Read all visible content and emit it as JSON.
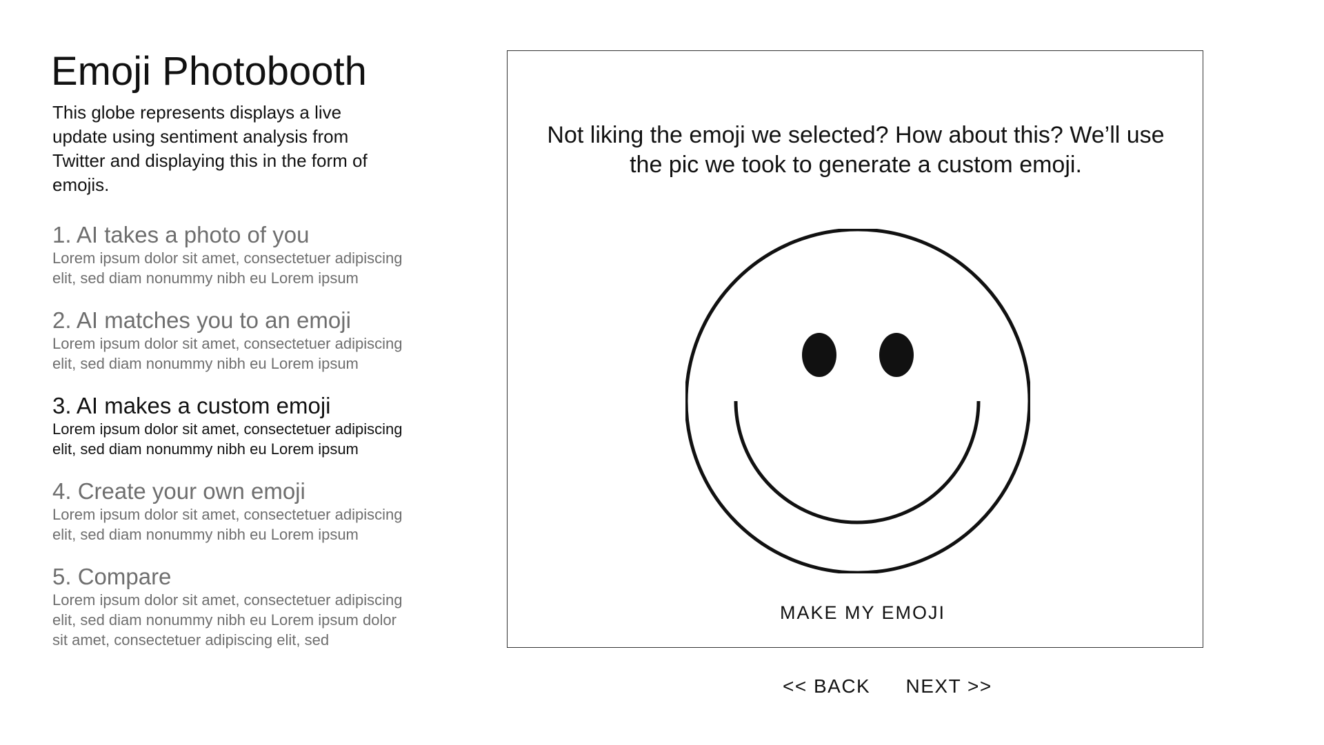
{
  "header": {
    "title": "Emoji Photobooth",
    "intro": "This globe represents displays a live update using sentiment analysis from Twitter and displaying this in the form of emojis."
  },
  "steps": [
    {
      "title": "1. AI takes a photo of you",
      "desc": "Lorem ipsum dolor sit amet, consectetuer adipiscing elit, sed diam nonummy nibh eu Lorem ipsum",
      "active": false
    },
    {
      "title": "2. AI matches you to an emoji",
      "desc": "Lorem ipsum dolor sit amet, consectetuer adipiscing elit, sed diam nonummy nibh eu Lorem ipsum",
      "active": false
    },
    {
      "title": "3. AI makes a custom emoji",
      "desc": "Lorem ipsum dolor sit amet, consectetuer adipiscing elit, sed diam nonummy nibh eu Lorem ipsum",
      "active": true
    },
    {
      "title": "4. Create your own emoji",
      "desc": "Lorem ipsum dolor sit amet, consectetuer adipiscing elit, sed diam nonummy nibh eu Lorem ipsum",
      "active": false
    },
    {
      "title": "5. Compare",
      "desc": "Lorem ipsum dolor sit amet, consectetuer adipiscing elit, sed diam nonummy nibh eu Lorem ipsum dolor sit amet, consectetuer adipiscing elit, sed",
      "active": false
    }
  ],
  "card": {
    "prompt": "Not liking the emoji we selected? How about this? We’ll use the pic we took to generate a custom emoji.",
    "emoji_icon": "smiley-face-icon",
    "make_label": "MAKE MY EMOJI"
  },
  "nav": {
    "back_label": "<< BACK",
    "next_label": "NEXT >>"
  },
  "colors": {
    "active_text": "#111111",
    "inactive_text": "#6e6e6e",
    "border": "#333333"
  }
}
